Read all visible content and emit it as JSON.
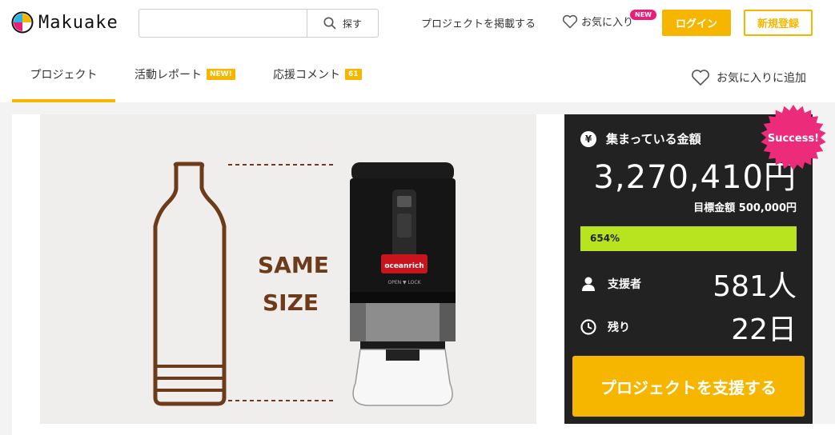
{
  "header": {
    "logo_text": "Makuake",
    "search_placeholder": "",
    "search_button": "探す",
    "post_project": "プロジェクトを掲載する",
    "favorites": "お気に入り",
    "favorites_badge": "NEW",
    "login": "ログイン",
    "signup": "新規登録"
  },
  "tabs": [
    {
      "label": "プロジェクト",
      "active": true
    },
    {
      "label": "活動レポート",
      "badge": "NEW!"
    },
    {
      "label": "応援コメント",
      "badge": "61"
    }
  ],
  "favorite_add": "お気に入りに追加",
  "image": {
    "text_line1": "SAME",
    "text_line2": "SIZE",
    "product_brand": "oceanrich",
    "product_lock_text": "OPEN ▼ LOCK"
  },
  "panel": {
    "raised_label": "集まっている金額",
    "yen_icon": "¥",
    "amount": "3,270,410円",
    "goal_label": "目標金額",
    "goal_value": "500,000円",
    "progress_percent": 654,
    "progress_text": "654%",
    "supporters_label": "支援者",
    "supporters_value": "581人",
    "remaining_label": "残り",
    "remaining_value": "22日",
    "support_button": "プロジェクトを支援する",
    "success_badge": "Success!"
  },
  "colors": {
    "accent": "#f6b600",
    "badge_pink": "#ec1c79",
    "progress": "#b8e31f",
    "panel_bg": "#222222"
  }
}
